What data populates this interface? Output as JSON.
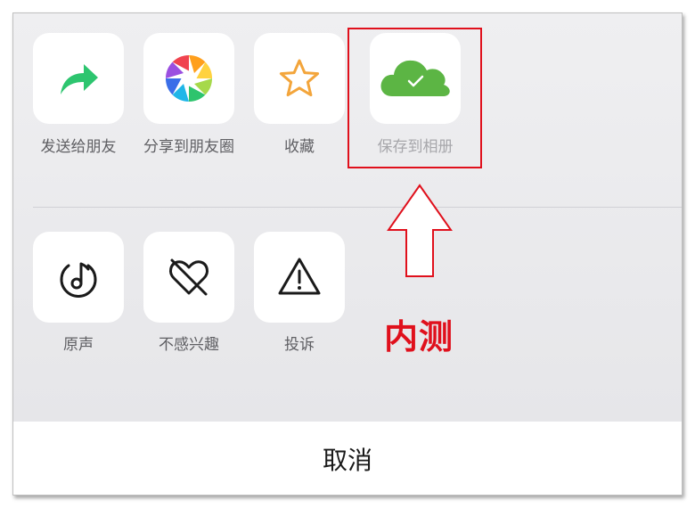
{
  "share_row": [
    {
      "label": "发送给朋友",
      "icon": "forward-arrow-icon"
    },
    {
      "label": "分享到朋友圈",
      "icon": "moments-aperture-icon"
    },
    {
      "label": "收藏",
      "icon": "star-icon"
    },
    {
      "label": "保存到相册",
      "icon": "cloud-check-icon"
    }
  ],
  "action_row": [
    {
      "label": "原声",
      "icon": "music-note-icon"
    },
    {
      "label": "不感兴趣",
      "icon": "broken-heart-icon"
    },
    {
      "label": "投诉",
      "icon": "warning-icon"
    }
  ],
  "cancel_label": "取消",
  "annotation": {
    "text": "内测",
    "color": "#e0101c"
  },
  "colors": {
    "forward": "#2dc56f",
    "star": "#f3a53b",
    "cloud": "#5cb544",
    "icon_dark": "#1a1a1a"
  }
}
